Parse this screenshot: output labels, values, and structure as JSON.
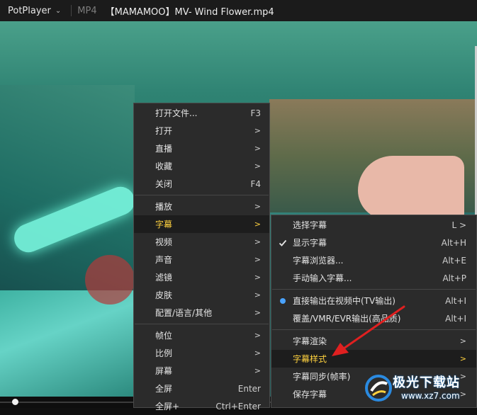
{
  "titlebar": {
    "app": "PotPlayer",
    "format": "MP4",
    "filename": "【MAMAMOO】MV- Wind Flower.mp4"
  },
  "menu1": {
    "items": [
      {
        "label": "打开文件...",
        "shortcut": "F3"
      },
      {
        "label": "打开",
        "shortcut": ">"
      },
      {
        "label": "直播",
        "shortcut": ">"
      },
      {
        "label": "收藏",
        "shortcut": ">"
      },
      {
        "label": "关闭",
        "shortcut": "F4"
      },
      {
        "label": "播放",
        "shortcut": ">"
      },
      {
        "label": "字幕",
        "shortcut": ">"
      },
      {
        "label": "视频",
        "shortcut": ">"
      },
      {
        "label": "声音",
        "shortcut": ">"
      },
      {
        "label": "滤镜",
        "shortcut": ">"
      },
      {
        "label": "皮肤",
        "shortcut": ">"
      },
      {
        "label": "配置/语言/其他",
        "shortcut": ">"
      },
      {
        "label": "帧位",
        "shortcut": ">"
      },
      {
        "label": "比例",
        "shortcut": ">"
      },
      {
        "label": "屏幕",
        "shortcut": ">"
      },
      {
        "label": "全屏",
        "shortcut": "Enter"
      },
      {
        "label": "全屏+",
        "shortcut": "Ctrl+Enter"
      }
    ]
  },
  "menu2": {
    "items": [
      {
        "label": "选择字幕",
        "shortcut": "L >"
      },
      {
        "label": "显示字幕",
        "shortcut": "Alt+H"
      },
      {
        "label": "字幕浏览器...",
        "shortcut": "Alt+E"
      },
      {
        "label": "手动输入字幕...",
        "shortcut": "Alt+P"
      },
      {
        "label": "直接输出在视频中(TV输出)",
        "shortcut": "Alt+I"
      },
      {
        "label": "覆盖/VMR/EVR输出(高品质)",
        "shortcut": "Alt+I"
      },
      {
        "label": "字幕渲染",
        "shortcut": ">"
      },
      {
        "label": "字幕样式",
        "shortcut": ">"
      },
      {
        "label": "字幕同步(帧率)",
        "shortcut": ">"
      },
      {
        "label": "保存字幕",
        "shortcut": ">"
      }
    ]
  },
  "watermark": {
    "title": "极光下载站",
    "url": "www.xz7.com"
  },
  "colors": {
    "highlight_text": "#ffd23f",
    "radio_dot": "#4aa3ff",
    "annotation_arrow": "#e02020"
  },
  "icons": {
    "checked": "check-icon",
    "radio": "radio-dot-icon",
    "submenu": "chevron-right-icon"
  }
}
